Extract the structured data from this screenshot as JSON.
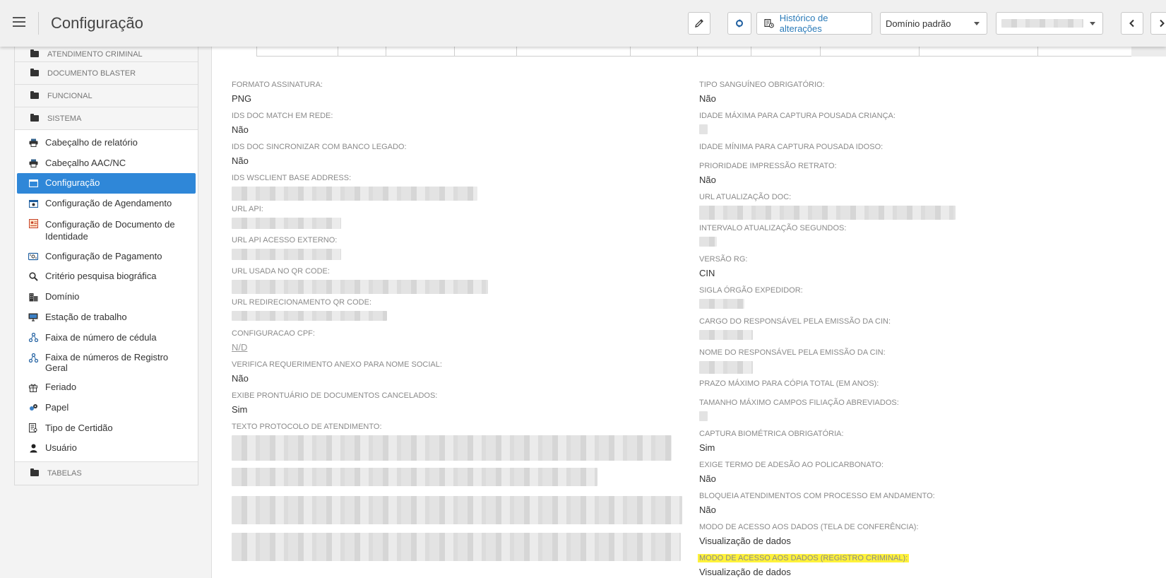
{
  "header": {
    "title": "Configuração",
    "history_label": "Histórico de alterações",
    "domain_select": "Domínio padrão",
    "user_select": ""
  },
  "sidebar": {
    "categories_top": [
      "ATENDIMENTO CRIMINAL",
      "DOCUMENTO BLASTER",
      "FUNCIONAL",
      "SISTEMA"
    ],
    "items": [
      {
        "label": "Cabeçalho de relatório",
        "icon": "printer-icon"
      },
      {
        "label": "Cabeçalho AAC/NC",
        "icon": "printer-icon"
      },
      {
        "label": "Configuração",
        "icon": "window-icon",
        "active": true
      },
      {
        "label": "Configuração de Agendamento",
        "icon": "calendar-icon"
      },
      {
        "label": "Configuração de Documento de Identidade",
        "icon": "id-card-icon"
      },
      {
        "label": "Configuração de Pagamento",
        "icon": "payment-icon"
      },
      {
        "label": "Critério pesquisa biográfica",
        "icon": "search-icon"
      },
      {
        "label": "Domínio",
        "icon": "building-icon"
      },
      {
        "label": "Estação de trabalho",
        "icon": "workstation-icon"
      },
      {
        "label": "Faixa de número de cédula",
        "icon": "network-icon"
      },
      {
        "label": "Faixa de números de Registro Geral",
        "icon": "network-icon"
      },
      {
        "label": "Feriado",
        "icon": "gift-icon"
      },
      {
        "label": "Papel",
        "icon": "paper-icon"
      },
      {
        "label": "Tipo de Certidão",
        "icon": "certificate-icon"
      },
      {
        "label": "Usuário",
        "icon": "user-icon"
      }
    ],
    "category_bottom": "TABELAS"
  },
  "left_fields": [
    {
      "label": "FORMATO ASSINATURA:",
      "value": "PNG"
    },
    {
      "label": "IDS DOC MATCH EM REDE:",
      "value": "Não"
    },
    {
      "label": "IDS DOC SINCRONIZAR COM BANCO LEGADO:",
      "value": "Não"
    },
    {
      "label": "IDS WSCLIENT BASE ADDRESS:",
      "value": ""
    },
    {
      "label": "URL API:",
      "value": ""
    },
    {
      "label": "URL API ACESSO EXTERNO:",
      "value": ""
    },
    {
      "label": "URL USADA NO QR CODE:",
      "value": ""
    },
    {
      "label": "URL REDIRECIONAMENTO QR CODE:",
      "value": ""
    },
    {
      "label": "CONFIGURACAO CPF:",
      "value": "N/D"
    },
    {
      "label": "VERIFICA REQUERIMENTO ANEXO PARA NOME SOCIAL:",
      "value": "Não"
    },
    {
      "label": "EXIBE PRONTUÁRIO DE DOCUMENTOS CANCELADOS:",
      "value": "Sim"
    },
    {
      "label": "TEXTO PROTOCOLO DE ATENDIMENTO:",
      "value": ""
    }
  ],
  "right_fields": [
    {
      "label": "TIPO SANGUÍNEO OBRIGATÓRIO:",
      "value": "Não"
    },
    {
      "label": "IDADE MÁXIMA PARA CAPTURA POUSADA CRIANÇA:",
      "value": ""
    },
    {
      "label": "IDADE MÍNIMA PARA CAPTURA POUSADA IDOSO:",
      "value": ""
    },
    {
      "label": "PRIORIDADE IMPRESSÃO RETRATO:",
      "value": "Não"
    },
    {
      "label": "URL ATUALIZAÇÃO DOC:",
      "value": ""
    },
    {
      "label": "INTERVALO ATUALIZAÇÃO SEGUNDOS:",
      "value": ""
    },
    {
      "label": "VERSÃO RG:",
      "value": "CIN"
    },
    {
      "label": "SIGLA ÓRGÃO EXPEDIDOR:",
      "value": ""
    },
    {
      "label": "CARGO DO RESPONSÁVEL PELA EMISSÃO DA CIN:",
      "value": ""
    },
    {
      "label": "NOME DO RESPONSÁVEL PELA EMISSÃO DA CIN:",
      "value": ""
    },
    {
      "label": "PRAZO MÁXIMO PARA CÓPIA TOTAL (EM ANOS):",
      "value": ""
    },
    {
      "label": "TAMANHO MÁXIMO CAMPOS FILIAÇÃO ABREVIADOS:",
      "value": ""
    },
    {
      "label": "CAPTURA BIOMÉTRICA OBRIGATÓRIA:",
      "value": "Sim"
    },
    {
      "label": "EXIGE TERMO DE ADESÃO AO POLICARBONATO:",
      "value": "Não"
    },
    {
      "label": "BLOQUEIA ATENDIMENTOS COM PROCESSO EM ANDAMENTO:",
      "value": "Não"
    },
    {
      "label": "MODO DE ACESSO AOS DADOS (TELA DE CONFERÊNCIA):",
      "value": "Visualização de dados"
    },
    {
      "label": "MODO DE ACESSO AOS DADOS (REGISTRO CRIMINAL):",
      "value": "Visualização de dados"
    }
  ],
  "colors": {
    "accent": "#2f87d8",
    "highlight": "#fff23a",
    "link": "#2a7ab8"
  }
}
